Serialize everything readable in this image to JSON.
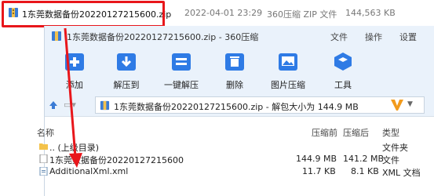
{
  "explorer": {
    "filename": "1东莞数据备份20220127215600.zip",
    "date": "2022-04-01 23:29",
    "type": "360压缩 ZIP 文件",
    "size": "144,563 KB"
  },
  "window": {
    "title": "1东莞数据备份20220127215600.zip - 360压缩",
    "menus": [
      "文件",
      "操作",
      "设置"
    ]
  },
  "toolbar": {
    "items": [
      {
        "label": "添加",
        "icon": "add-icon"
      },
      {
        "label": "解压到",
        "icon": "extract-to-icon"
      },
      {
        "label": "一键解压",
        "icon": "one-click-extract-icon"
      },
      {
        "label": "删除",
        "icon": "delete-icon"
      },
      {
        "label": "图片压缩",
        "icon": "image-compress-icon"
      },
      {
        "label": "工具",
        "icon": "tools-icon"
      }
    ]
  },
  "address": {
    "path": "1东莞数据备份20220127215600.zip - 解包大小为 144.9 MB"
  },
  "list": {
    "headers": [
      "名称",
      "压缩前",
      "压缩后",
      "类型"
    ],
    "rows": [
      {
        "name": ".. (上级目录)",
        "before": "",
        "after": "",
        "type": "文件夹",
        "icon": "folder-icon"
      },
      {
        "name": "1东莞数据备份20220127215600",
        "before": "144.9 MB",
        "after": "141.2 MB",
        "type": "文件",
        "icon": "file-icon"
      },
      {
        "name": "AdditionalXml.xml",
        "before": "11.7 KB",
        "after": "8.1 KB",
        "type": "XML 文档",
        "icon": "xml-file-icon"
      }
    ]
  },
  "colors": {
    "highlight_red": "#e8161b",
    "window_bg": "#eaf2fb"
  }
}
